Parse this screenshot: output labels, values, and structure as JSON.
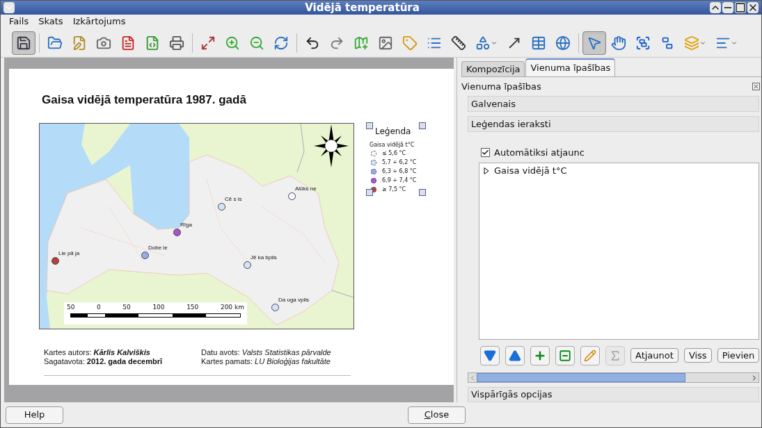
{
  "window": {
    "title": "Vidējā temperatūra"
  },
  "menu": [
    "Fails",
    "Skats",
    "Izkārtojums"
  ],
  "toolbar": [
    [
      {
        "selected": true,
        "menu": false
      }
    ],
    [
      {
        "selected": false,
        "menu": false
      },
      {
        "selected": false,
        "menu": false
      },
      {
        "selected": false,
        "menu": false
      },
      {
        "selected": false,
        "menu": false
      },
      {
        "selected": false,
        "menu": false
      },
      {
        "selected": false,
        "menu": false
      }
    ],
    [
      {
        "selected": false,
        "menu": false
      },
      {
        "selected": false,
        "menu": false
      },
      {
        "selected": false,
        "menu": false
      },
      {
        "selected": false,
        "menu": false
      }
    ],
    [
      {
        "selected": false,
        "menu": false
      },
      {
        "selected": false,
        "menu": false
      },
      {
        "selected": false,
        "menu": false
      },
      {
        "selected": false,
        "menu": false
      },
      {
        "selected": false,
        "menu": false
      },
      {
        "selected": false,
        "menu": false
      },
      {
        "selected": false,
        "menu": false
      },
      {
        "selected": false,
        "menu": true
      },
      {
        "selected": false,
        "menu": false
      },
      {
        "selected": false,
        "menu": false
      },
      {
        "selected": false,
        "menu": false
      }
    ],
    [
      {
        "selected": true,
        "menu": false
      },
      {
        "selected": false,
        "menu": false
      },
      {
        "selected": false,
        "menu": false
      },
      {
        "selected": false,
        "menu": false
      },
      {
        "selected": false,
        "menu": true
      },
      {
        "selected": false,
        "menu": true
      }
    ]
  ],
  "composition": {
    "title": "Gaisa vidējā temperatūra 1987. gadā",
    "cities": [
      {
        "name": "Lie pā ja",
        "color": "#b8403f"
      },
      {
        "name": "Dobe le",
        "color": "#9aa9e8"
      },
      {
        "name": "Rīga",
        "color": "#a855c8"
      },
      {
        "name": "Cē s is",
        "color": "#d4e4f7"
      },
      {
        "name": "Alūks ne",
        "color": "#f4f8fd"
      },
      {
        "name": "Jē ka bpils",
        "color": "#d4e4f7"
      },
      {
        "name": "Da uga vpils",
        "color": "#d4e4f7"
      }
    ],
    "scale_labels": [
      "50",
      "0",
      "50",
      "100",
      "150",
      "200 km"
    ],
    "legend": {
      "title": "Leģenda",
      "layer": "Gaisa vidējā t°C",
      "items": [
        {
          "label": "≤ 5,6 °C",
          "color": "#ffffff"
        },
        {
          "label": "5,7 ÷ 6,2 °C",
          "color": "#d4e4f7"
        },
        {
          "label": "6,3 ÷ 6,8 °C",
          "color": "#9aa9e8"
        },
        {
          "label": "6,9 ÷ 7,4 °C",
          "color": "#a855c8"
        },
        {
          "label": "≥ 7,5 °C",
          "color": "#b8403f"
        }
      ]
    },
    "footer": [
      [
        "Kartes autors: **Kārlis Kalviškis**",
        "Sagatavota: **2012. gada decembrī**"
      ],
      [
        "Datu avots: *Valsts Statistikas pārvalde*",
        "Kartes pamats: *LU Bioloģijas fakultāte*"
      ]
    ]
  },
  "panel": {
    "tabs": [
      {
        "label": "Kompozīcija",
        "selected": false
      },
      {
        "label": "Vienuma īpašības",
        "selected": true
      }
    ],
    "header": "Vienuma īpašības",
    "sections": [
      "Galvenais",
      "Leģendas ieraksti"
    ],
    "auto_update": {
      "label": "Automātiksi atjaunc",
      "checked": true
    },
    "tree": [
      {
        "label": "Gaisa vidējā t°C",
        "expanded": false
      }
    ],
    "icon_buttons": [
      {
        "disabled": false
      },
      {
        "disabled": false
      },
      {
        "disabled": false
      },
      {
        "disabled": false
      },
      {
        "disabled": false
      },
      {
        "disabled": true
      }
    ],
    "text_buttons": [
      "Atjaunot",
      "Viss",
      "Pievien"
    ],
    "general": "Vispārīgās opcijas"
  },
  "buttons": {
    "help": "Help",
    "close": "Close"
  }
}
